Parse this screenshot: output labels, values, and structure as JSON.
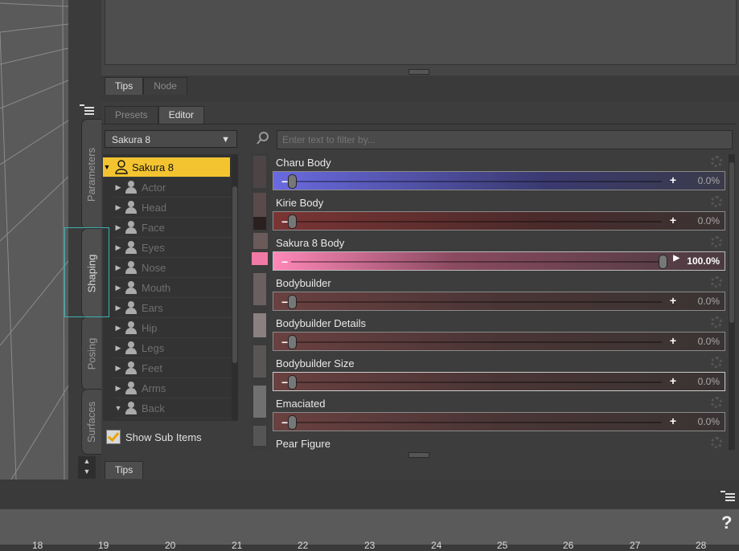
{
  "top_tabs": [
    "Tips",
    "Node"
  ],
  "main_tabs": [
    "Presets",
    "Editor"
  ],
  "side_tabs": [
    "Parameters",
    "Shaping",
    "Posing",
    "Surfaces"
  ],
  "figure_select": "Sakura 8",
  "tree": [
    {
      "label": "Sakura 8",
      "expanded": true,
      "selected": true
    },
    {
      "label": "Actor"
    },
    {
      "label": "Head"
    },
    {
      "label": "Face"
    },
    {
      "label": "Eyes"
    },
    {
      "label": "Nose"
    },
    {
      "label": "Mouth"
    },
    {
      "label": "Ears"
    },
    {
      "label": "Hip"
    },
    {
      "label": "Legs"
    },
    {
      "label": "Feet"
    },
    {
      "label": "Arms"
    },
    {
      "label": "Back",
      "expanded": true
    }
  ],
  "show_sub_items": "Show Sub Items",
  "filter_placeholder": "Enter text to filter by...",
  "properties": [
    {
      "name": "Charu Body",
      "value": "0.0%",
      "level": 0,
      "color": "#8a8aff"
    },
    {
      "name": "Kirie Body",
      "value": "0.0%",
      "level": 0,
      "color": "#b05050"
    },
    {
      "name": "Sakura 8 Body",
      "value": "100.0%",
      "level": 1,
      "color": "#ff7fb0"
    },
    {
      "name": "Bodybuilder",
      "value": "0.0%",
      "level": 0,
      "color": "#b07070"
    },
    {
      "name": "Bodybuilder Details",
      "value": "0.0%",
      "level": 0,
      "color": "#b07070"
    },
    {
      "name": "Bodybuilder Size",
      "value": "0.0%",
      "level": 0,
      "color": "#b07070"
    },
    {
      "name": "Emaciated",
      "value": "0.0%",
      "level": 0,
      "color": "#b07070"
    },
    {
      "name": "Pear Figure",
      "value": "",
      "level": 0,
      "color": "#b07070"
    }
  ],
  "bottom_tab": "Tips",
  "help_icon": "?",
  "ruler_ticks": [
    "18",
    "19",
    "20",
    "21",
    "22",
    "23",
    "24",
    "25",
    "26",
    "27",
    "28"
  ]
}
